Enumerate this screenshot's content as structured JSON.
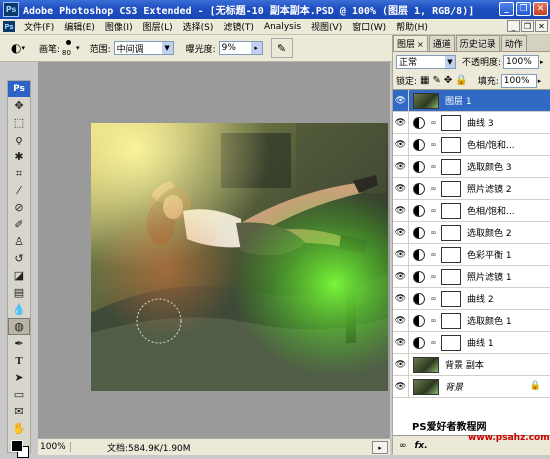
{
  "window": {
    "title": "Adobe Photoshop CS3 Extended - [无标题-10 副本副本.PSD @ 100% (图层 1, RGB/8)]",
    "app_icon": "Ps"
  },
  "menu": {
    "items": [
      "文件(F)",
      "编辑(E)",
      "图像(I)",
      "图层(L)",
      "选择(S)",
      "滤镜(T)",
      "Analysis",
      "视图(V)",
      "窗口(W)",
      "帮助(H)"
    ]
  },
  "options_bar": {
    "brush_label": "画笔:",
    "brush_size": "80",
    "range_label": "范围:",
    "range_value": "中间调",
    "exposure_label": "曝光度:",
    "exposure_value": "9%"
  },
  "toolbox": {
    "title": "Ps"
  },
  "status_bar": {
    "zoom": "100%",
    "doc_size": "文档:584.9K/1.90M"
  },
  "layers_panel": {
    "tabs": [
      "图层",
      "通道",
      "历史记录",
      "动作"
    ],
    "blend_mode": "正常",
    "opacity_label": "不透明度:",
    "opacity_value": "100%",
    "lock_label": "锁定:",
    "fill_label": "填充:",
    "fill_value": "100%",
    "layers": [
      {
        "name": "图层 1",
        "kind": "pixel",
        "selected": true
      },
      {
        "name": "曲线 3",
        "kind": "adjustment"
      },
      {
        "name": "色相/饱和...",
        "kind": "adjustment"
      },
      {
        "name": "选取颜色 3",
        "kind": "adjustment"
      },
      {
        "name": "照片滤镜 2",
        "kind": "adjustment"
      },
      {
        "name": "色相/饱和...",
        "kind": "adjustment"
      },
      {
        "name": "选取颜色 2",
        "kind": "adjustment"
      },
      {
        "name": "色彩平衡 1",
        "kind": "adjustment"
      },
      {
        "name": "照片滤镜 1",
        "kind": "adjustment"
      },
      {
        "name": "曲线 2",
        "kind": "adjustment"
      },
      {
        "name": "选取颜色 1",
        "kind": "adjustment"
      },
      {
        "name": "曲线 1",
        "kind": "adjustment"
      },
      {
        "name": "背景 副本",
        "kind": "pixel"
      },
      {
        "name": "背景",
        "kind": "background",
        "italic": true
      }
    ]
  },
  "watermark": {
    "text": "PS爱好者教程网",
    "url": "www.psahz.com"
  }
}
